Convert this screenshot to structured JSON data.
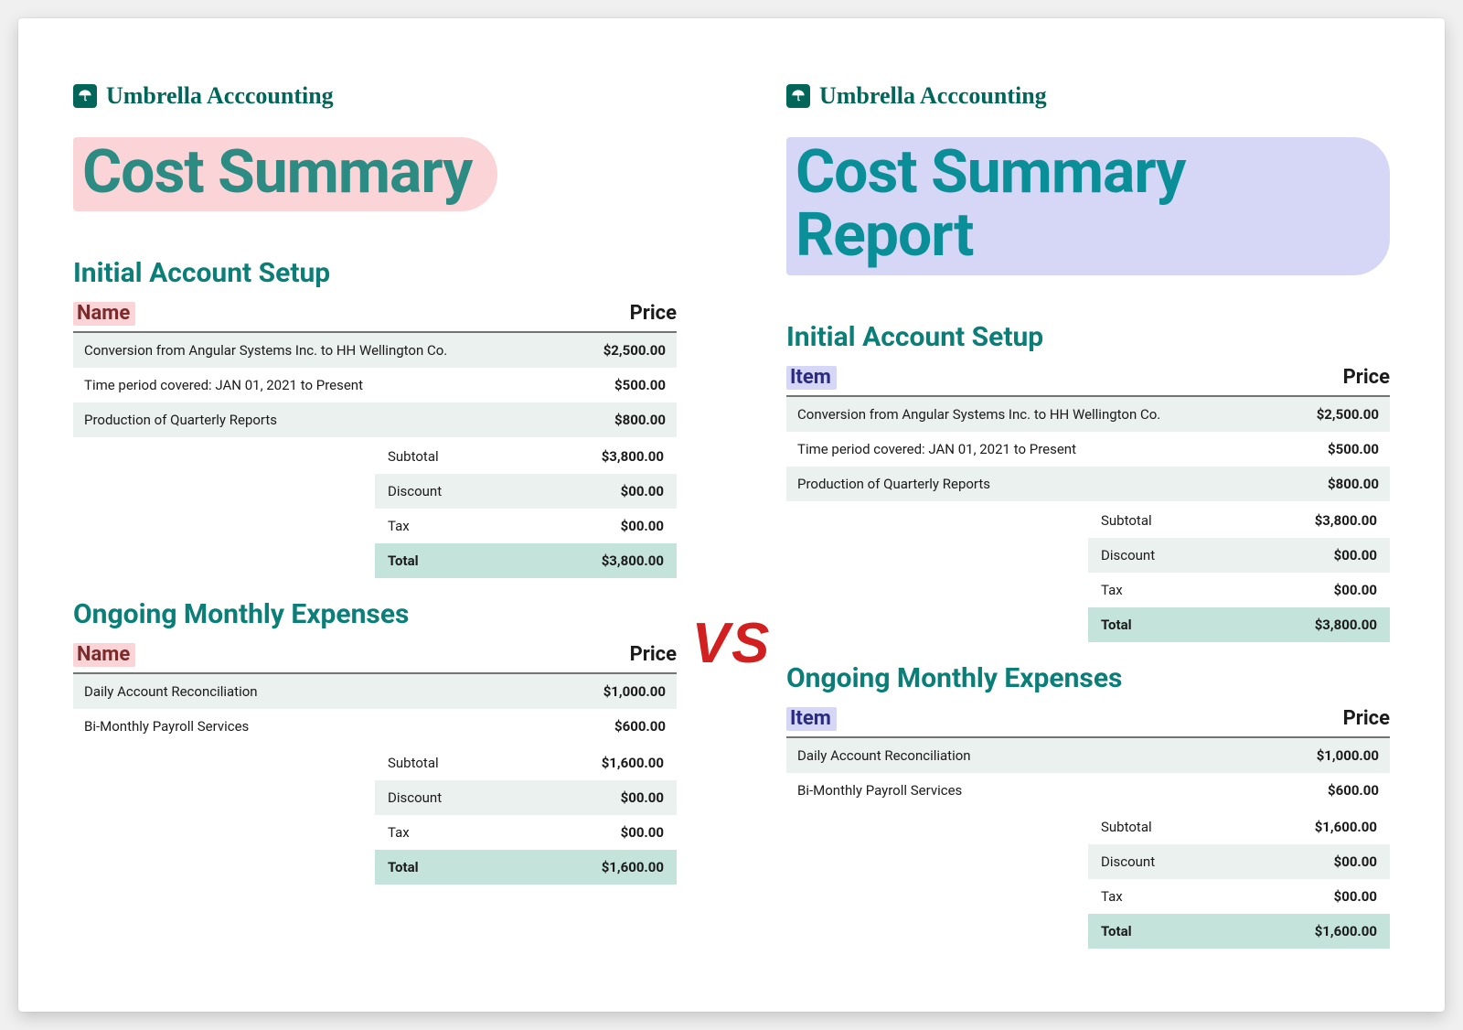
{
  "brand": "Umbrella Acccounting",
  "left": {
    "title": "Cost Summary",
    "name_header": "Name",
    "price_header": "Price",
    "section1": {
      "heading": "Initial Account Setup",
      "rows": [
        {
          "desc": "Conversion from Angular Systems Inc. to HH Wellington Co.",
          "price": "$2,500.00"
        },
        {
          "desc": "Time period covered: JAN 01, 2021 to Present",
          "price": "$500.00"
        },
        {
          "desc": "Production of Quarterly Reports",
          "price": "$800.00"
        }
      ],
      "totals": {
        "subtotal_label": "Subtotal",
        "subtotal": "$3,800.00",
        "discount_label": "Discount",
        "discount": "$00.00",
        "tax_label": "Tax",
        "tax": "$00.00",
        "total_label": "Total",
        "total": "$3,800.00"
      }
    },
    "section2": {
      "heading": "Ongoing Monthly Expenses",
      "rows": [
        {
          "desc": "Daily Account Reconciliation",
          "price": "$1,000.00"
        },
        {
          "desc": "Bi-Monthly Payroll Services",
          "price": "$600.00"
        }
      ],
      "totals": {
        "subtotal_label": "Subtotal",
        "subtotal": "$1,600.00",
        "discount_label": "Discount",
        "discount": "$00.00",
        "tax_label": "Tax",
        "tax": "$00.00",
        "total_label": "Total",
        "total": "$1,600.00"
      }
    }
  },
  "right": {
    "title": "Cost Summary Report",
    "name_header": "Item",
    "price_header": "Price",
    "section1": {
      "heading": "Initial Account Setup",
      "rows": [
        {
          "desc": "Conversion from Angular Systems Inc. to HH Wellington Co.",
          "price": "$2,500.00"
        },
        {
          "desc": "Time period covered: JAN 01, 2021 to Present",
          "price": "$500.00"
        },
        {
          "desc": "Production of Quarterly Reports",
          "price": "$800.00"
        }
      ],
      "totals": {
        "subtotal_label": "Subtotal",
        "subtotal": "$3,800.00",
        "discount_label": "Discount",
        "discount": "$00.00",
        "tax_label": "Tax",
        "tax": "$00.00",
        "total_label": "Total",
        "total": "$3,800.00"
      }
    },
    "section2": {
      "heading": "Ongoing Monthly Expenses",
      "rows": [
        {
          "desc": "Daily Account Reconciliation",
          "price": "$1,000.00"
        },
        {
          "desc": "Bi-Monthly Payroll Services",
          "price": "$600.00"
        }
      ],
      "totals": {
        "subtotal_label": "Subtotal",
        "subtotal": "$1,600.00",
        "discount_label": "Discount",
        "discount": "$00.00",
        "tax_label": "Tax",
        "tax": "$00.00",
        "total_label": "Total",
        "total": "$1,600.00"
      }
    }
  },
  "vs_label": "VS"
}
